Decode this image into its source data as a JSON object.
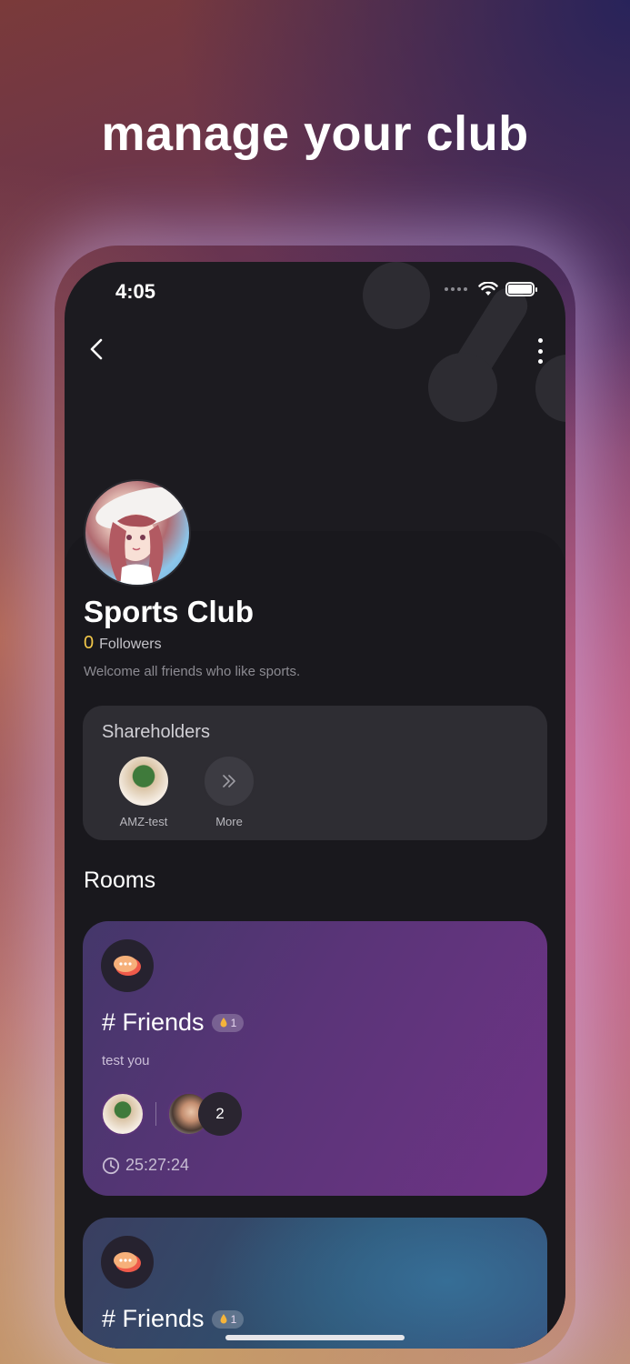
{
  "headline": "manage your club",
  "status_bar": {
    "time": "4:05"
  },
  "club": {
    "name": "Sports Club",
    "followers_count": "0",
    "followers_label": "Followers",
    "description": "Welcome all friends who like sports."
  },
  "shareholders": {
    "title": "Shareholders",
    "items": [
      {
        "label": "AMZ-test"
      },
      {
        "label": "More"
      }
    ]
  },
  "rooms": {
    "title": "Rooms",
    "list": [
      {
        "name": "# Friends",
        "hot_count": "1",
        "description": "test you",
        "member_count": "2",
        "timer": "25:27:24"
      },
      {
        "name": "# Friends",
        "hot_count": "1"
      }
    ]
  },
  "colors": {
    "accent_followers": "#f3c84a",
    "phone_bg": "#1c1b20",
    "card_bg": "#2e2d33",
    "room1_gradient_end": "#6e3385"
  },
  "icons": [
    "back-chevron-icon",
    "more-vertical-icon",
    "wifi-icon",
    "battery-icon",
    "chat-bubbles-icon",
    "fire-icon",
    "clock-icon",
    "double-chevron-right-icon"
  ]
}
